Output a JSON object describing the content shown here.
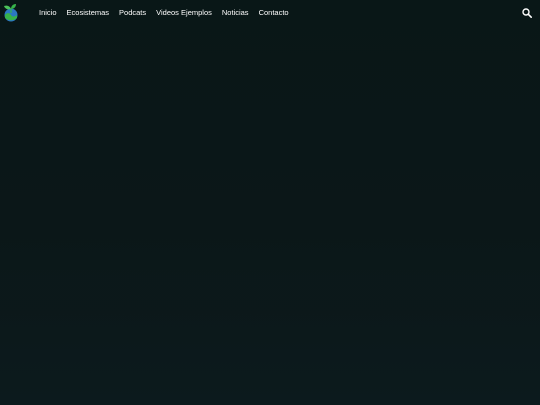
{
  "header": {
    "logo_icon": "plant-globe-logo-icon",
    "nav": [
      {
        "label": "Inicio"
      },
      {
        "label": "Ecosistemas"
      },
      {
        "label": "Podcats"
      },
      {
        "label": "Videos Ejemplos"
      },
      {
        "label": "Noticias"
      },
      {
        "label": "Contacto"
      }
    ],
    "search_icon": "search-icon"
  },
  "colors": {
    "background": "#0a1717",
    "nav_text": "#ffffff",
    "logo_green": "#37b34a",
    "logo_blue": "#2b78c2"
  }
}
